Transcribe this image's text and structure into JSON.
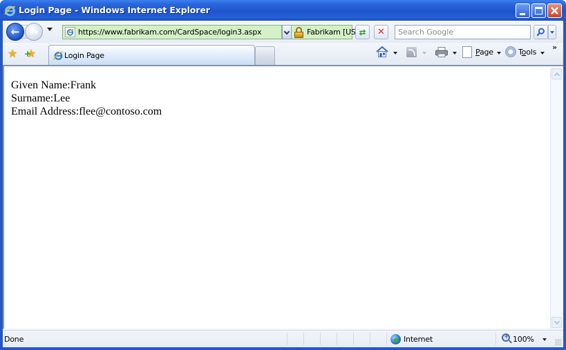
{
  "window": {
    "title": "Login Page - Windows Internet Explorer",
    "controls": {
      "minimize": "minimize",
      "maximize": "maximize",
      "close": "close"
    }
  },
  "navigation": {
    "back_icon": "back-arrow-icon",
    "forward_icon": "forward-arrow-icon",
    "back_glyph": "←",
    "forward_glyph": "→",
    "address": "https://www.fabrikam.com/CardSpace/login3.aspx",
    "security_report": "Fabrikam [US]",
    "refresh_glyph": "⇄",
    "stop_glyph": "✕",
    "search_placeholder": "Search Google",
    "search_value": "",
    "search_glyph": "⚲"
  },
  "tabs": [
    {
      "label": "Login Page",
      "active": true
    }
  ],
  "command_bar": {
    "favorites_glyph": "★",
    "add_favorite_glyph": "★",
    "add_glyph": "+",
    "page_label_first": "P",
    "page_label_rest": "age",
    "tools_label_first": "T",
    "tools_label_underlined": "o",
    "tools_label_rest": "ols",
    "more_glyph": "»"
  },
  "page": {
    "lines": [
      "Given Name:Frank",
      "Surname:Lee",
      "Email Address:flee@contoso.com"
    ]
  },
  "status_bar": {
    "status": "Done",
    "zone": "Internet",
    "zoom": "100%"
  },
  "colors": {
    "title_bar": "#2458c8",
    "address_secure_bg": "#d4f0c6",
    "close_button": "#c9452a"
  }
}
